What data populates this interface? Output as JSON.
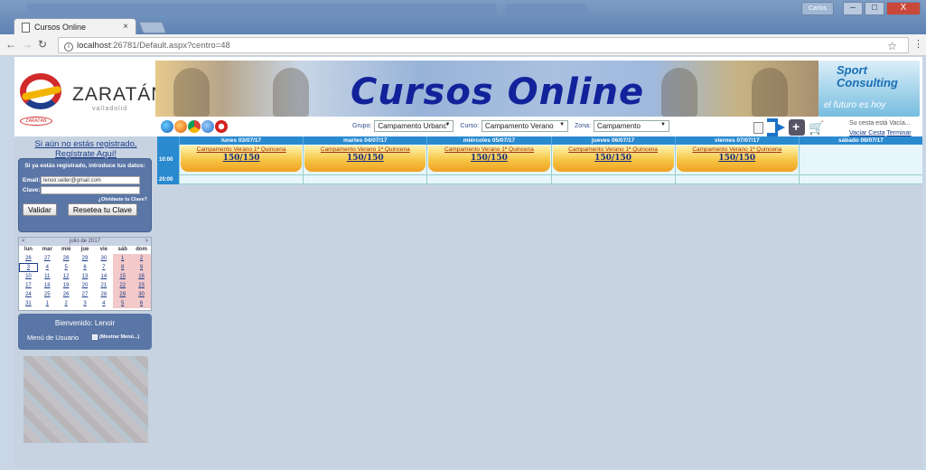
{
  "browser": {
    "tab_title": "Cursos Online",
    "tab_close": "×",
    "url_host": "localhost",
    "url_rest": ":26781/Default.aspx?centro=48",
    "window_user": "Carlos",
    "minimize": "–",
    "maximize": "□",
    "close": "X"
  },
  "header": {
    "logo_name": "ZARATÁN",
    "logo_sub": "valladolid",
    "logo_small": "ZARATÁN",
    "banner_title": "Cursos Online",
    "sport_line1": "Sport",
    "sport_line2": "Consulting",
    "sport_tag": "el futuro es hoy"
  },
  "filters": {
    "grupo_label": "Grupo:",
    "grupo_value": "Campamento Urbanc",
    "curso_label": "Curso:",
    "curso_value": "Campamento Verano",
    "zona_label": "Zona:",
    "zona_value": "Campamento"
  },
  "cart": {
    "status": "Su cesta está Vacía...",
    "empty_link": "Vaciar Cesta",
    "finish_link": "Terminar"
  },
  "register": {
    "line1": "Si aún no estás registrado,",
    "line2": "Regístrate Aquí!"
  },
  "login": {
    "title": "Si ya estás registrado, introduce tus datos:",
    "email_label": "Email:",
    "email_value": "lenoir.seller@gmail.com",
    "password_label": "Clave:",
    "forgot": "¿Olvidaste tu Clave?",
    "validate_button": "Validar",
    "reset_button": "Resetea tu Clave"
  },
  "calendar": {
    "month": "julio de 2017",
    "prev": "<",
    "next": ">",
    "weekdays": [
      "lun",
      "mar",
      "mié",
      "jue",
      "vie",
      "sáb",
      "dom"
    ],
    "weeks": [
      [
        "26",
        "27",
        "28",
        "29",
        "30",
        "1",
        "2"
      ],
      [
        "3",
        "4",
        "5",
        "6",
        "7",
        "8",
        "9"
      ],
      [
        "10",
        "11",
        "12",
        "13",
        "14",
        "15",
        "16"
      ],
      [
        "17",
        "18",
        "19",
        "20",
        "21",
        "22",
        "23"
      ],
      [
        "24",
        "25",
        "26",
        "27",
        "28",
        "29",
        "30"
      ],
      [
        "31",
        "1",
        "2",
        "3",
        "4",
        "5",
        "6"
      ]
    ],
    "selected": "3"
  },
  "user": {
    "welcome": "Bienvenido: Lenoir",
    "menu_label": "Menú de Usuario",
    "show_menu": "(Mostrar Menú...)"
  },
  "schedule": {
    "days": [
      "lunes 03/07/17",
      "martes 04/07/17",
      "miércoles 05/07/17",
      "jueves 06/07/17",
      "viernes 07/07/17",
      "sábado 08/07/17"
    ],
    "times": [
      "10:00",
      "20:00"
    ],
    "slot_name": "Campamento Verano 1ª Quincena",
    "slot_capacity": "150/150"
  }
}
